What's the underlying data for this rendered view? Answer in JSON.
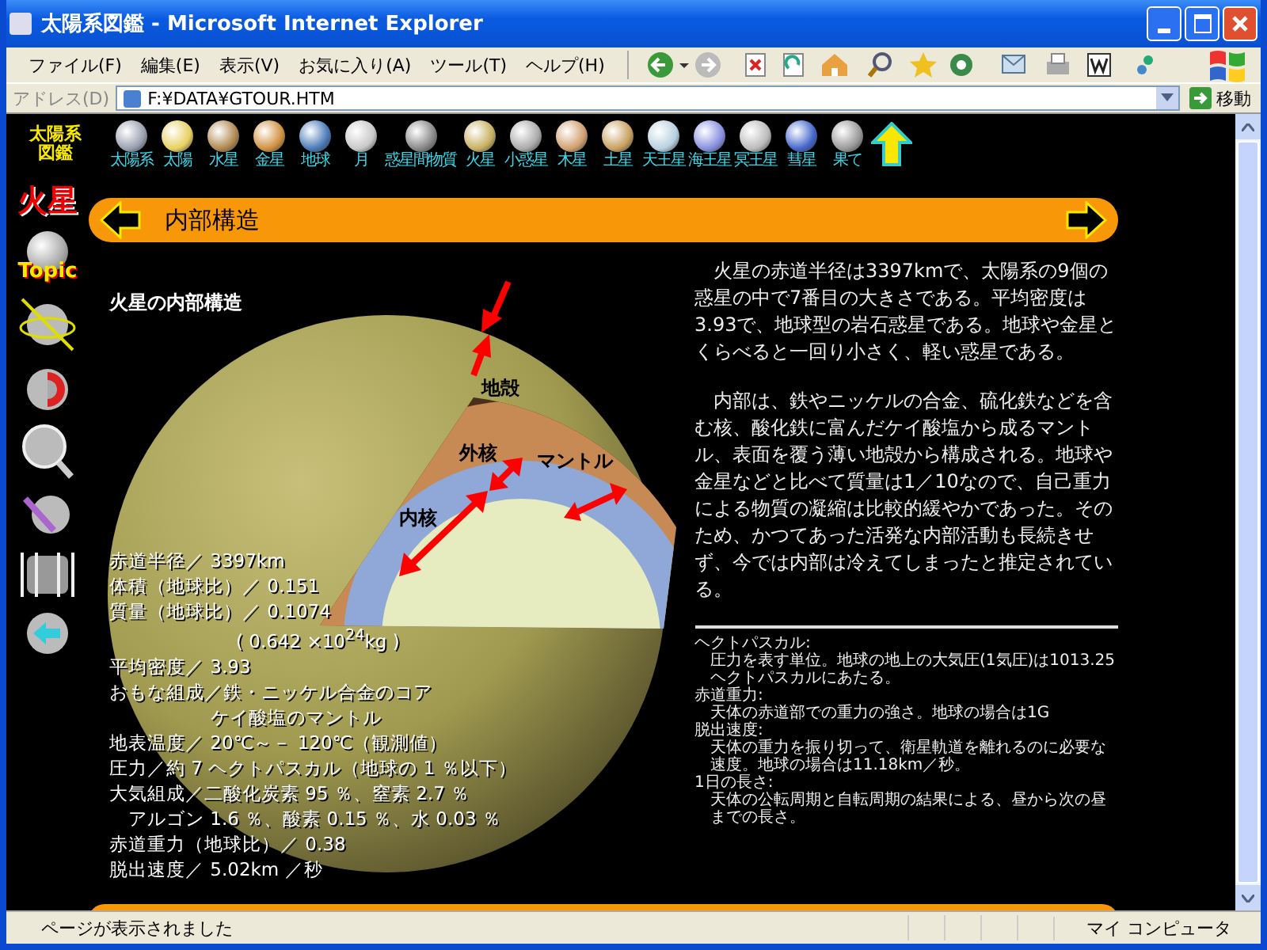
{
  "window": {
    "title": "太陽系図鑑 - Microsoft Internet Explorer"
  },
  "menu": [
    {
      "label": "ファイル(F)"
    },
    {
      "label": "編集(E)"
    },
    {
      "label": "表示(V)"
    },
    {
      "label": "お気に入り(A)"
    },
    {
      "label": "ツール(T)"
    },
    {
      "label": "ヘルプ(H)"
    }
  ],
  "address": {
    "label": "アドレス(D)",
    "value": "F:¥DATA¥GTOUR.HTM",
    "go": "移動"
  },
  "nav": {
    "logo": [
      "太陽系",
      "図鑑"
    ],
    "planets": [
      {
        "label": "太陽系"
      },
      {
        "label": "太陽"
      },
      {
        "label": "水星"
      },
      {
        "label": "金星"
      },
      {
        "label": "地球"
      },
      {
        "label": "月"
      },
      {
        "label": "惑星間物質"
      },
      {
        "label": "火星"
      },
      {
        "label": "小惑星"
      },
      {
        "label": "木星"
      },
      {
        "label": "土星"
      },
      {
        "label": "天王星"
      },
      {
        "label": "海王星"
      },
      {
        "label": "冥王星"
      },
      {
        "label": "彗星"
      },
      {
        "label": "果て"
      }
    ]
  },
  "sidebar": {
    "planet": "火星",
    "topic": "Topic"
  },
  "header": {
    "title": "内部構造"
  },
  "diagram": {
    "title": "火星の内部構造",
    "layers": [
      {
        "label": "地殻"
      },
      {
        "label": "外核"
      },
      {
        "label": "マントル"
      },
      {
        "label": "内核"
      }
    ]
  },
  "stats": [
    {
      "text": "赤道半径／ 3397km",
      "kind": "line"
    },
    {
      "text": "体積（地球比）／ 0.151",
      "kind": "line"
    },
    {
      "text": "質量（地球比）／ 0.1074",
      "kind": "line"
    },
    {
      "text": "( 0.642 ×10$^{24}$kg )",
      "kind": "continuation"
    },
    {
      "text": "平均密度／ 3.93",
      "kind": "line"
    },
    {
      "text": "おもな組成／鉄・ニッケル合金のコア",
      "kind": "line"
    },
    {
      "text": "ケイ酸塩のマントル",
      "kind": "deep"
    },
    {
      "text": "地表温度／ 20℃～－ 120℃（観測値）",
      "kind": "line"
    },
    {
      "text": "圧力／約 7 ヘクトパスカル（地球の 1 ％以下）",
      "kind": "line"
    },
    {
      "text": "大気組成／二酸化炭素 95 ％、窒素 2.7 ％",
      "kind": "line"
    },
    {
      "text": "アルゴン 1.6 ％、酸素 0.15 ％、水 0.03 ％",
      "kind": "indent"
    },
    {
      "text": "赤道重力（地球比）／ 0.38",
      "kind": "line"
    },
    {
      "text": "脱出速度／ 5.02km ／秒",
      "kind": "line"
    }
  ],
  "paragraphs": [
    "火星の赤道半径は3397kmで、太陽系の9個の惑星の中で7番目の大きさである。平均密度は3.93で、地球型の岩石惑星である。地球や金星とくらべると一回り小さく、軽い惑星である。",
    "内部は、鉄やニッケルの合金、硫化鉄などを含む核、酸化鉄に富んだケイ酸塩から成るマントル、表面を覆う薄い地殻から構成される。地球や金星などと比べて質量は1／10なので、自己重力による物質の凝縮は比較的緩やかであった。そのため、かつてあった活発な内部活動も長続きせず、今では内部は冷えてしまったと推定されている。"
  ],
  "notes": [
    {
      "term": "ヘクトパスカル:",
      "definition": "圧力を表す単位。地球の地上の大気圧(1気圧)は1013.25ヘクトパスカルにあたる。"
    },
    {
      "term": "赤道重力:",
      "definition": "天体の赤道部での重力の強さ。地球の場合は1G"
    },
    {
      "term": "脱出速度:",
      "definition": "天体の重力を振り切って、衛星軌道を離れるのに必要な速度。地球の場合は11.18km／秒。"
    },
    {
      "term": "1日の長さ:",
      "definition": "天体の公転周期と自転周期の結果による、昼から次の昼までの長さ。"
    }
  ],
  "status": {
    "text": "ページが表示されました",
    "zone": "マイ コンピュータ"
  }
}
